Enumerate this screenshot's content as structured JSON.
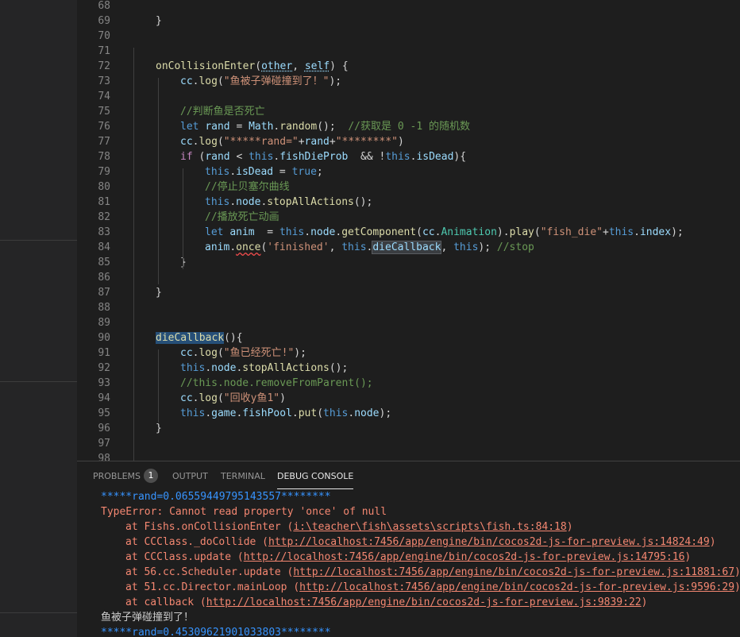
{
  "editor": {
    "lines": [
      {
        "num": "68",
        "indent": 0,
        "tokens": []
      },
      {
        "num": "69",
        "indent": 1,
        "tokens": [
          {
            "t": "}",
            "c": "plain"
          }
        ]
      },
      {
        "num": "70",
        "indent": 0,
        "tokens": []
      },
      {
        "num": "71",
        "indent": 0,
        "tokens": []
      },
      {
        "num": "72",
        "indent": 1,
        "tokens": [
          {
            "t": "onCollisionEnter",
            "c": "fn"
          },
          {
            "t": "(",
            "c": "plain"
          },
          {
            "t": "other",
            "c": "var",
            "s": "dot"
          },
          {
            "t": ", ",
            "c": "plain"
          },
          {
            "t": "self",
            "c": "var",
            "s": "dot"
          },
          {
            "t": ") {",
            "c": "plain"
          }
        ]
      },
      {
        "num": "73",
        "indent": 2,
        "tokens": [
          {
            "t": "cc",
            "c": "var"
          },
          {
            "t": ".",
            "c": "plain"
          },
          {
            "t": "log",
            "c": "fn"
          },
          {
            "t": "(",
            "c": "plain"
          },
          {
            "t": "\"鱼被子弹碰撞到了！\"",
            "c": "str"
          },
          {
            "t": ");",
            "c": "plain"
          }
        ]
      },
      {
        "num": "74",
        "indent": 0,
        "tokens": []
      },
      {
        "num": "75",
        "indent": 2,
        "tokens": [
          {
            "t": "//判断鱼是否死亡",
            "c": "cm"
          }
        ]
      },
      {
        "num": "76",
        "indent": 2,
        "tokens": [
          {
            "t": "let",
            "c": "kw"
          },
          {
            "t": " ",
            "c": "plain"
          },
          {
            "t": "rand",
            "c": "var"
          },
          {
            "t": " = ",
            "c": "plain"
          },
          {
            "t": "Math",
            "c": "var"
          },
          {
            "t": ".",
            "c": "plain"
          },
          {
            "t": "random",
            "c": "fn"
          },
          {
            "t": "();  ",
            "c": "plain"
          },
          {
            "t": "//获取是 0 -1 的随机数",
            "c": "cm"
          }
        ]
      },
      {
        "num": "77",
        "indent": 2,
        "tokens": [
          {
            "t": "cc",
            "c": "var"
          },
          {
            "t": ".",
            "c": "plain"
          },
          {
            "t": "log",
            "c": "fn"
          },
          {
            "t": "(",
            "c": "plain"
          },
          {
            "t": "\"*****rand=\"",
            "c": "str"
          },
          {
            "t": "+",
            "c": "plain"
          },
          {
            "t": "rand",
            "c": "var"
          },
          {
            "t": "+",
            "c": "plain"
          },
          {
            "t": "\"********\"",
            "c": "str"
          },
          {
            "t": ")",
            "c": "plain"
          }
        ]
      },
      {
        "num": "78",
        "indent": 2,
        "tokens": [
          {
            "t": "if",
            "c": "ctl"
          },
          {
            "t": " (",
            "c": "plain"
          },
          {
            "t": "rand",
            "c": "var"
          },
          {
            "t": " < ",
            "c": "plain"
          },
          {
            "t": "this",
            "c": "kw"
          },
          {
            "t": ".",
            "c": "plain"
          },
          {
            "t": "fishDieProb",
            "c": "var"
          },
          {
            "t": "  && !",
            "c": "plain"
          },
          {
            "t": "this",
            "c": "kw"
          },
          {
            "t": ".",
            "c": "plain"
          },
          {
            "t": "isDead",
            "c": "var"
          },
          {
            "t": "){",
            "c": "plain"
          }
        ]
      },
      {
        "num": "79",
        "indent": 3,
        "tokens": [
          {
            "t": "this",
            "c": "kw"
          },
          {
            "t": ".",
            "c": "plain"
          },
          {
            "t": "isDead",
            "c": "var"
          },
          {
            "t": " = ",
            "c": "plain"
          },
          {
            "t": "true",
            "c": "kw"
          },
          {
            "t": ";",
            "c": "plain"
          }
        ]
      },
      {
        "num": "80",
        "indent": 3,
        "tokens": [
          {
            "t": "//停止贝塞尔曲线",
            "c": "cm"
          }
        ]
      },
      {
        "num": "81",
        "indent": 3,
        "tokens": [
          {
            "t": "this",
            "c": "kw"
          },
          {
            "t": ".",
            "c": "plain"
          },
          {
            "t": "node",
            "c": "var"
          },
          {
            "t": ".",
            "c": "plain"
          },
          {
            "t": "stopAllActions",
            "c": "fn"
          },
          {
            "t": "();",
            "c": "plain"
          }
        ]
      },
      {
        "num": "82",
        "indent": 3,
        "tokens": [
          {
            "t": "//播放死亡动画",
            "c": "cm"
          }
        ]
      },
      {
        "num": "83",
        "indent": 3,
        "tokens": [
          {
            "t": "let",
            "c": "kw"
          },
          {
            "t": " ",
            "c": "plain"
          },
          {
            "t": "anim",
            "c": "var"
          },
          {
            "t": "  = ",
            "c": "plain"
          },
          {
            "t": "this",
            "c": "kw"
          },
          {
            "t": ".",
            "c": "plain"
          },
          {
            "t": "node",
            "c": "var"
          },
          {
            "t": ".",
            "c": "plain"
          },
          {
            "t": "getComponent",
            "c": "fn"
          },
          {
            "t": "(",
            "c": "plain"
          },
          {
            "t": "cc",
            "c": "var"
          },
          {
            "t": ".",
            "c": "plain"
          },
          {
            "t": "Animation",
            "c": "type"
          },
          {
            "t": ").",
            "c": "plain"
          },
          {
            "t": "play",
            "c": "fn"
          },
          {
            "t": "(",
            "c": "plain"
          },
          {
            "t": "\"fish_die\"",
            "c": "str"
          },
          {
            "t": "+",
            "c": "plain"
          },
          {
            "t": "this",
            "c": "kw"
          },
          {
            "t": ".",
            "c": "plain"
          },
          {
            "t": "index",
            "c": "var"
          },
          {
            "t": ");",
            "c": "plain"
          }
        ]
      },
      {
        "num": "84",
        "indent": 3,
        "tokens": [
          {
            "t": "anim",
            "c": "var"
          },
          {
            "t": ".",
            "c": "plain"
          },
          {
            "t": "once",
            "c": "fn",
            "s": "wavy"
          },
          {
            "t": "(",
            "c": "plain"
          },
          {
            "t": "'finished'",
            "c": "str"
          },
          {
            "t": ", ",
            "c": "plain"
          },
          {
            "t": "this",
            "c": "kw"
          },
          {
            "t": ".",
            "c": "plain"
          },
          {
            "t": "dieCallback",
            "c": "var",
            "s": "hl2"
          },
          {
            "t": ", ",
            "c": "plain"
          },
          {
            "t": "this",
            "c": "kw"
          },
          {
            "t": "); ",
            "c": "plain"
          },
          {
            "t": "//stop",
            "c": "cm"
          }
        ]
      },
      {
        "num": "85",
        "indent": 2,
        "tokens": [
          {
            "t": "}",
            "c": "plain"
          }
        ]
      },
      {
        "num": "86",
        "indent": 0,
        "tokens": []
      },
      {
        "num": "87",
        "indent": 1,
        "tokens": [
          {
            "t": "}",
            "c": "plain"
          }
        ]
      },
      {
        "num": "88",
        "indent": 0,
        "tokens": []
      },
      {
        "num": "89",
        "indent": 0,
        "tokens": []
      },
      {
        "num": "90",
        "indent": 1,
        "tokens": [
          {
            "t": "dieCallback",
            "c": "fn",
            "s": "hl"
          },
          {
            "t": "(){",
            "c": "plain"
          }
        ]
      },
      {
        "num": "91",
        "indent": 2,
        "tokens": [
          {
            "t": "cc",
            "c": "var"
          },
          {
            "t": ".",
            "c": "plain"
          },
          {
            "t": "log",
            "c": "fn"
          },
          {
            "t": "(",
            "c": "plain"
          },
          {
            "t": "\"鱼已经死亡!\"",
            "c": "str"
          },
          {
            "t": ");",
            "c": "plain"
          }
        ]
      },
      {
        "num": "92",
        "indent": 2,
        "tokens": [
          {
            "t": "this",
            "c": "kw"
          },
          {
            "t": ".",
            "c": "plain"
          },
          {
            "t": "node",
            "c": "var"
          },
          {
            "t": ".",
            "c": "plain"
          },
          {
            "t": "stopAllActions",
            "c": "fn"
          },
          {
            "t": "();",
            "c": "plain"
          }
        ]
      },
      {
        "num": "93",
        "indent": 2,
        "tokens": [
          {
            "t": "//this.node.removeFromParent();",
            "c": "cm"
          }
        ]
      },
      {
        "num": "94",
        "indent": 2,
        "tokens": [
          {
            "t": "cc",
            "c": "var"
          },
          {
            "t": ".",
            "c": "plain"
          },
          {
            "t": "log",
            "c": "fn"
          },
          {
            "t": "(",
            "c": "plain"
          },
          {
            "t": "\"回收y鱼1\"",
            "c": "str"
          },
          {
            "t": ")",
            "c": "plain"
          }
        ]
      },
      {
        "num": "95",
        "indent": 2,
        "tokens": [
          {
            "t": "this",
            "c": "kw"
          },
          {
            "t": ".",
            "c": "plain"
          },
          {
            "t": "game",
            "c": "var"
          },
          {
            "t": ".",
            "c": "plain"
          },
          {
            "t": "fishPool",
            "c": "var"
          },
          {
            "t": ".",
            "c": "plain"
          },
          {
            "t": "put",
            "c": "fn"
          },
          {
            "t": "(",
            "c": "plain"
          },
          {
            "t": "this",
            "c": "kw"
          },
          {
            "t": ".",
            "c": "plain"
          },
          {
            "t": "node",
            "c": "var"
          },
          {
            "t": ");",
            "c": "plain"
          }
        ]
      },
      {
        "num": "96",
        "indent": 1,
        "tokens": [
          {
            "t": "}",
            "c": "plain"
          }
        ]
      },
      {
        "num": "97",
        "indent": 0,
        "tokens": []
      },
      {
        "num": "98",
        "indent": 0,
        "tokens": []
      }
    ]
  },
  "panel": {
    "tabs": [
      {
        "label": "PROBLEMS",
        "badge": "1",
        "active": false
      },
      {
        "label": "OUTPUT",
        "active": false
      },
      {
        "label": "TERMINAL",
        "active": false
      },
      {
        "label": "DEBUG CONSOLE",
        "active": true
      }
    ],
    "console": [
      {
        "kind": "info",
        "indent": 0,
        "parts": [
          {
            "t": "*****rand=0.06559449795143557********"
          }
        ]
      },
      {
        "kind": "err",
        "indent": 0,
        "parts": [
          {
            "t": "TypeError: Cannot read property 'once' of null"
          }
        ]
      },
      {
        "kind": "err",
        "indent": 1,
        "parts": [
          {
            "t": "at Fishs.onCollisionEnter ("
          },
          {
            "t": "i:\\teacher\\fish\\assets\\scripts\\fish.ts:84:18",
            "link": true
          },
          {
            "t": ")"
          }
        ]
      },
      {
        "kind": "err",
        "indent": 1,
        "parts": [
          {
            "t": "at CCClass._doCollide ("
          },
          {
            "t": "http://localhost:7456/app/engine/bin/cocos2d-js-for-preview.js:14824:49",
            "link": true
          },
          {
            "t": ")"
          }
        ]
      },
      {
        "kind": "err",
        "indent": 1,
        "parts": [
          {
            "t": "at CCClass.update ("
          },
          {
            "t": "http://localhost:7456/app/engine/bin/cocos2d-js-for-preview.js:14795:16",
            "link": true
          },
          {
            "t": ")"
          }
        ]
      },
      {
        "kind": "err",
        "indent": 1,
        "parts": [
          {
            "t": "at 56.cc.Scheduler.update ("
          },
          {
            "t": "http://localhost:7456/app/engine/bin/cocos2d-js-for-preview.js:11881:67",
            "link": true
          },
          {
            "t": ")"
          }
        ]
      },
      {
        "kind": "err",
        "indent": 1,
        "parts": [
          {
            "t": "at 51.cc.Director.mainLoop ("
          },
          {
            "t": "http://localhost:7456/app/engine/bin/cocos2d-js-for-preview.js:9596:29",
            "link": true
          },
          {
            "t": ")"
          }
        ]
      },
      {
        "kind": "err",
        "indent": 1,
        "parts": [
          {
            "t": "at callback ("
          },
          {
            "t": "http://localhost:7456/app/engine/bin/cocos2d-js-for-preview.js:9839:22",
            "link": true
          },
          {
            "t": ")"
          }
        ]
      },
      {
        "kind": "text",
        "indent": 0,
        "parts": [
          {
            "t": "鱼被子弹碰撞到了！"
          }
        ]
      },
      {
        "kind": "info",
        "indent": 0,
        "parts": [
          {
            "t": "*****rand=0.45309621901033803********"
          }
        ]
      }
    ]
  },
  "colors": {
    "editor_bg": "#1e1e1e",
    "sidebar_bg": "#252526",
    "error": "#f48771",
    "info": "#3794ff"
  }
}
